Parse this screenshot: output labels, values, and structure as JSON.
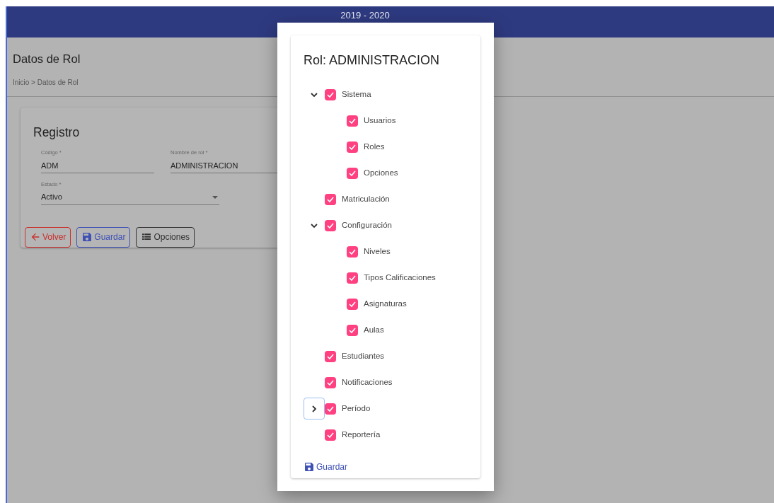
{
  "header": {
    "title": "2019 - 2020"
  },
  "page": {
    "title": "Datos de Rol",
    "breadcrumb": "Inicio > Datos de Rol"
  },
  "form": {
    "title": "Registro",
    "fields": [
      {
        "label": "Código *",
        "value": "ADM"
      },
      {
        "label": "Nombre de rol *",
        "value": "ADMINISTRACION"
      }
    ],
    "select": {
      "label": "Estado *",
      "value": "Activo"
    },
    "buttons": [
      {
        "label": "Volver",
        "kind": "back"
      },
      {
        "label": "Guardar",
        "kind": "save"
      },
      {
        "label": "Opciones",
        "kind": "options"
      }
    ]
  },
  "dialog": {
    "title": "Rol: ADMINISTRACION",
    "tree": [
      {
        "label": "Sistema",
        "checked": true,
        "expanded": true,
        "children": [
          {
            "label": "Usuarios",
            "checked": true
          },
          {
            "label": "Roles",
            "checked": true
          },
          {
            "label": "Opciones",
            "checked": true
          }
        ]
      },
      {
        "label": "Matriculación",
        "checked": true
      },
      {
        "label": "Configuración",
        "checked": true,
        "expanded": true,
        "children": [
          {
            "label": "Niveles",
            "checked": true
          },
          {
            "label": "Tipos Calificaciones",
            "checked": true
          },
          {
            "label": "Asignaturas",
            "checked": true
          },
          {
            "label": "Aulas",
            "checked": true
          }
        ]
      },
      {
        "label": "Estudiantes",
        "checked": true
      },
      {
        "label": "Notificaciones",
        "checked": true
      },
      {
        "label": "Período",
        "checked": true,
        "expanded": false,
        "focused": true
      },
      {
        "label": "Reportería",
        "checked": true
      }
    ],
    "save_label": "Guardar"
  }
}
